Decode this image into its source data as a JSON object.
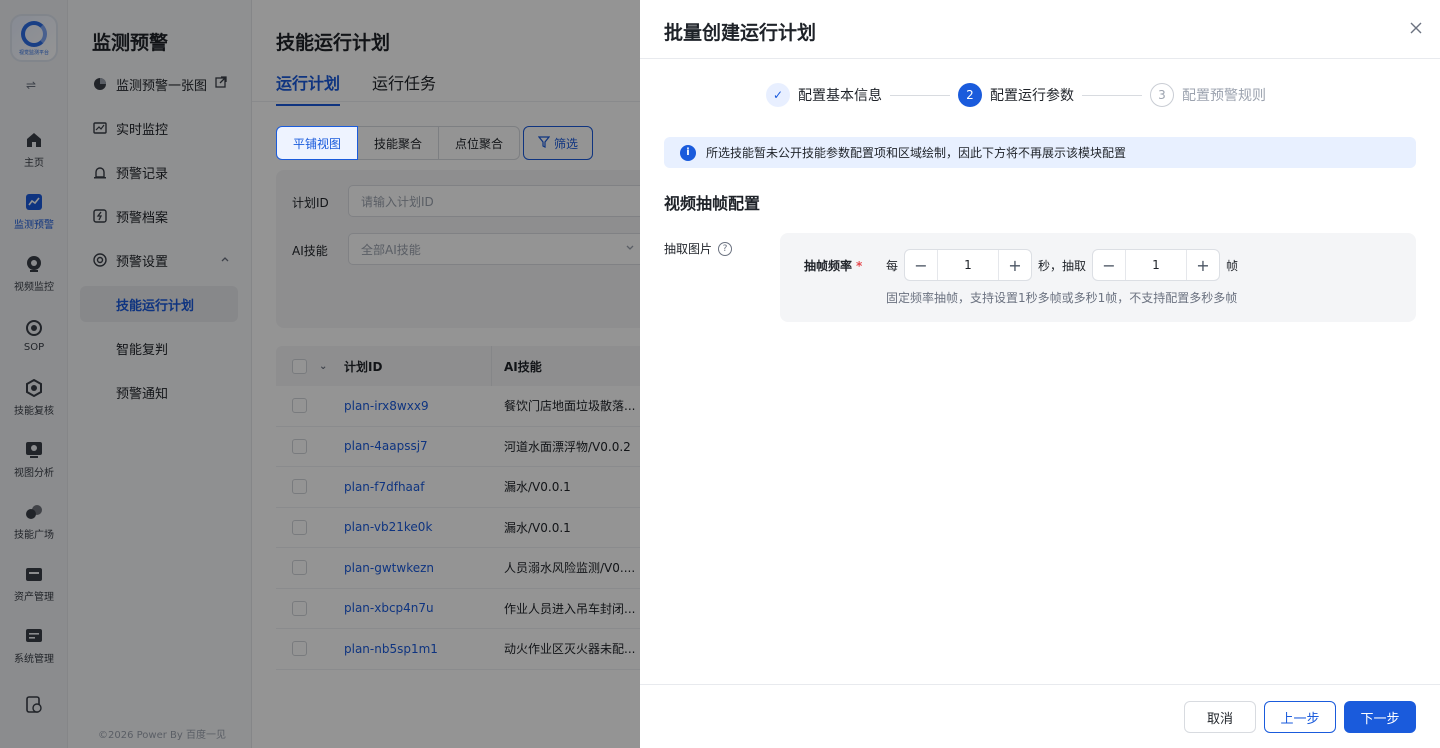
{
  "rail": {
    "logo_caption": "视觉监测平台",
    "items": [
      {
        "label": "主页",
        "icon": "home-icon"
      },
      {
        "label": "监测预警",
        "icon": "chart-icon",
        "active": true
      },
      {
        "label": "视频监控",
        "icon": "camera-icon"
      },
      {
        "label": "SOP",
        "icon": "sop-icon"
      },
      {
        "label": "技能复核",
        "icon": "hexagon-icon"
      },
      {
        "label": "视图分析",
        "icon": "search-screen-icon"
      },
      {
        "label": "技能广场",
        "icon": "shapes-icon"
      },
      {
        "label": "资产管理",
        "icon": "asset-icon"
      },
      {
        "label": "系统管理",
        "icon": "system-icon"
      }
    ]
  },
  "submenu": {
    "title": "监测预警",
    "items": [
      {
        "label": "监测预警一张图"
      },
      {
        "label": "实时监控"
      },
      {
        "label": "预警记录"
      },
      {
        "label": "预警档案"
      },
      {
        "label": "预警设置"
      },
      {
        "label": "技能运行计划"
      },
      {
        "label": "智能复判"
      },
      {
        "label": "预警通知"
      }
    ],
    "footer": "©2026 Power By 百度一见"
  },
  "main": {
    "title": "技能运行计划",
    "tabs": [
      {
        "label": "运行计划"
      },
      {
        "label": "运行任务"
      }
    ],
    "views": [
      {
        "label": "平铺视图"
      },
      {
        "label": "技能聚合"
      },
      {
        "label": "点位聚合"
      }
    ],
    "filter_label": "筛选",
    "filters": {
      "plan_id_label": "计划ID",
      "plan_id_placeholder": "请输入计划ID",
      "skill_label": "AI技能",
      "skill_value": "全部AI技能"
    },
    "table": {
      "headers": {
        "id": "计划ID",
        "skill": "AI技能"
      },
      "rows": [
        {
          "id": "plan-irx8wxx9",
          "skill": "餐饮门店地面垃圾散落..."
        },
        {
          "id": "plan-4aapssj7",
          "skill": "河道水面漂浮物/V0.0.2"
        },
        {
          "id": "plan-f7dfhaaf",
          "skill": "漏水/V0.0.1"
        },
        {
          "id": "plan-vb21ke0k",
          "skill": "漏水/V0.0.1"
        },
        {
          "id": "plan-gwtwkezn",
          "skill": "人员溺水风险监测/V0...."
        },
        {
          "id": "plan-xbcp4n7u",
          "skill": "作业人员进入吊车封闭..."
        },
        {
          "id": "plan-nb5sp1m1",
          "skill": "动火作业区灭火器未配..."
        }
      ]
    }
  },
  "drawer": {
    "title": "批量创建运行计划",
    "steps": [
      {
        "num": "✓",
        "label": "配置基本信息"
      },
      {
        "num": "2",
        "label": "配置运行参数"
      },
      {
        "num": "3",
        "label": "配置预警规则"
      }
    ],
    "alert": "所选技能暂未公开技能参数配置项和区域绘制，因此下方将不再展示该模块配置",
    "section_title": "视频抽帧配置",
    "field_label": "抽取图片",
    "config": {
      "label": "抽帧频率",
      "required_mark": "*",
      "every": "每",
      "seconds_value": "1",
      "mid_text": "秒，抽取",
      "frames_value": "1",
      "frame_unit": "帧",
      "hint": "固定频率抽帧，支持设置1秒多帧或多秒1帧，不支持配置多秒多帧"
    },
    "buttons": {
      "cancel": "取消",
      "prev": "上一步",
      "next": "下一步"
    }
  }
}
